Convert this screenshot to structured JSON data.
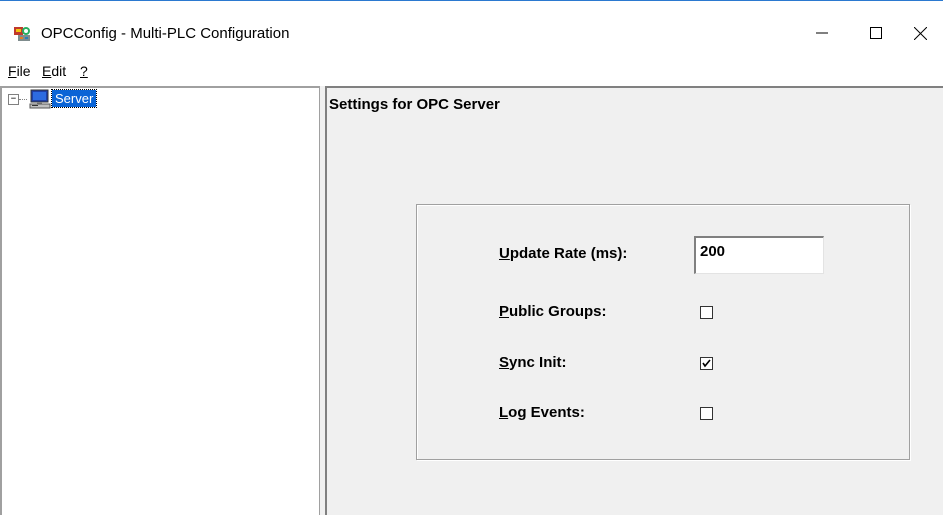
{
  "window": {
    "title": "OPCConfig - Multi-PLC Configuration",
    "icon": "opcconfig-app-icon"
  },
  "menu": {
    "file": {
      "label": "File",
      "mnemonic": "F",
      "rest": "ile"
    },
    "edit": {
      "label": "Edit",
      "mnemonic": "E",
      "rest": "dit"
    },
    "help": {
      "label": "?",
      "mnemonic": "?"
    }
  },
  "tree": {
    "expander": "⊟",
    "root": {
      "label": "Server",
      "icon": "computer-icon",
      "selected": true
    }
  },
  "settings": {
    "title": "Settings for OPC Server",
    "update_rate": {
      "label_mnemonic": "U",
      "label_rest": "pdate Rate (ms):",
      "value": "200"
    },
    "public_groups": {
      "label_mnemonic": "P",
      "label_rest": "ublic Groups:",
      "checked": false
    },
    "sync_init": {
      "label_mnemonic": "S",
      "label_rest": "ync Init:",
      "checked": true
    },
    "log_events": {
      "label_mnemonic": "L",
      "label_rest": "og Events:",
      "checked": false
    }
  },
  "colors": {
    "selection": "#0a64d6",
    "panel": "#f0f0f0",
    "title_border": "#2b79d0"
  }
}
